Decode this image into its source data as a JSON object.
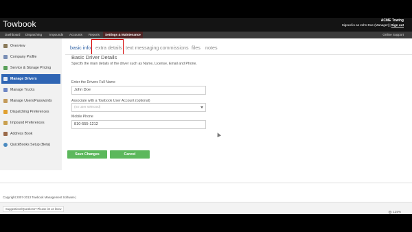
{
  "header": {
    "app_name": "Towbook",
    "company": "ACME Towing",
    "signed_in": "Signed in as John Doe (Manager)",
    "signout": "Sign out"
  },
  "nav": {
    "items": [
      {
        "label": "Dashboard"
      },
      {
        "label": "Dispatching"
      },
      {
        "label": "Impounds"
      },
      {
        "label": "Accounts"
      },
      {
        "label": "Reports"
      },
      {
        "label": "Settings & Maintenance",
        "active": true
      }
    ],
    "support": "Online Support"
  },
  "sidebar": {
    "items": [
      {
        "label": "Overview",
        "icon": "wrench-icon"
      },
      {
        "label": "Company Profile",
        "icon": "building-icon"
      },
      {
        "label": "Service & Storage Pricing",
        "icon": "money-icon"
      },
      {
        "label": "Manage Drivers",
        "icon": "driver-icon",
        "active": true
      },
      {
        "label": "Manage Trucks",
        "icon": "truck-icon"
      },
      {
        "label": "Manage Users/Passwords",
        "icon": "users-icon"
      },
      {
        "label": "Dispatching Preferences",
        "icon": "dispatch-icon"
      },
      {
        "label": "Impound Preferences",
        "icon": "lock-icon"
      },
      {
        "label": "Address Book",
        "icon": "address-book-icon"
      },
      {
        "label": "QuickBooks Setup (Beta)",
        "icon": "quickbooks-icon"
      }
    ]
  },
  "tabs": [
    {
      "label": "basic info",
      "active": true
    },
    {
      "label": "extra details",
      "highlighted": true
    },
    {
      "label": "text messaging"
    },
    {
      "label": "commissions"
    },
    {
      "label": "files"
    },
    {
      "label": "notes"
    }
  ],
  "form": {
    "title": "Basic Driver Details",
    "description": "Specify the main details of the driver such as Name, License, Email and Phone.",
    "name_label": "Enter the Drivers Full Name",
    "name_value": "John Doe",
    "account_label": "Associate with a Towbook User Account (optional)",
    "account_value": "(no user selected)",
    "phone_label": "Mobile Phone",
    "phone_value": "810-555-1212"
  },
  "buttons": {
    "save": "Save Changes",
    "cancel": "Cancel"
  },
  "footer": {
    "copyright": "Copyright 2007-2013 Towbook Management Software |",
    "suggestions": "Suggestions/Questions? Please let us know",
    "zoom": "125%"
  },
  "colors": {
    "header_bg": "#141414",
    "nav_bg": "#3b3b3b",
    "nav_active": "#4e2626",
    "sidebar_active": "#2f65b4",
    "tab_active": "#2c5fa3",
    "highlight": "#d40000",
    "button_green": "#5cb85c"
  }
}
